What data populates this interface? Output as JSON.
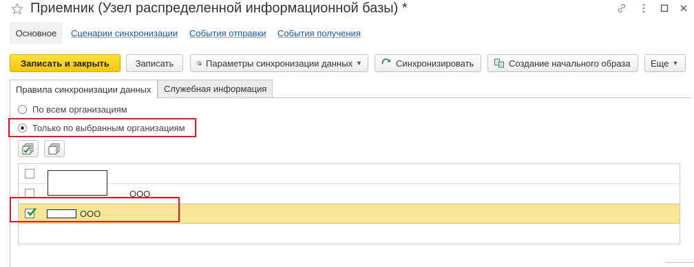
{
  "window": {
    "title": "Приемник (Узел распределенной информационной базы) *",
    "icons": [
      "star-icon",
      "link-icon",
      "more-vertical-icon",
      "maximize-icon",
      "close-icon"
    ]
  },
  "nav": {
    "active": "Основное",
    "links": [
      "Сценарии синхронизации",
      "События отправки",
      "События получения"
    ]
  },
  "toolbar": {
    "save_close": "Записать и закрыть",
    "save": "Записать",
    "sync_params": "Параметры синхронизации данных",
    "sync": "Синхронизировать",
    "initial_image": "Создание начального образа",
    "more": "Еще"
  },
  "tabs": {
    "rules": "Правила синхронизации данных",
    "service": "Служебная информация"
  },
  "radios": {
    "all_orgs": "По всем организациям",
    "selected_orgs": "Только по выбранным организациям",
    "selected": "selected_orgs"
  },
  "list": {
    "rows": [
      {
        "checked": false,
        "text": ""
      },
      {
        "checked": false,
        "text": "ООО"
      },
      {
        "checked": true,
        "text": "ООО"
      }
    ]
  },
  "colors": {
    "accent_yellow": "#f5cc17",
    "selected_row": "#fbe697",
    "highlight_red": "#e8141c",
    "link_blue": "#1d57a6"
  }
}
